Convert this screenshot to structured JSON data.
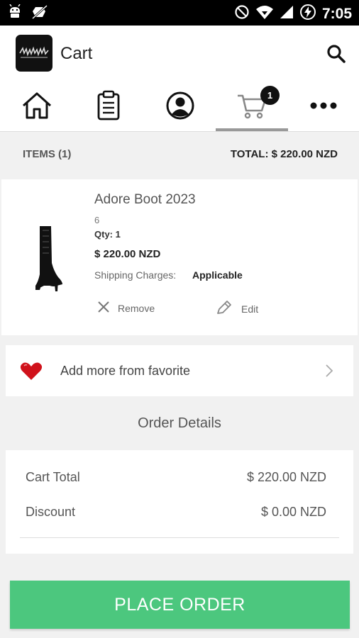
{
  "status_bar": {
    "time": "7:05",
    "icons": [
      "android-icon",
      "no-notifications-icon",
      "do-not-disturb-icon",
      "wifi-icon",
      "signal-icon",
      "battery-charging-icon"
    ]
  },
  "app_bar": {
    "title": "Cart",
    "logo_icon": "brand-logo",
    "search_icon": "search-icon"
  },
  "nav": {
    "items": [
      {
        "name": "home",
        "icon": "home-icon"
      },
      {
        "name": "orders",
        "icon": "clipboard-icon"
      },
      {
        "name": "account",
        "icon": "user-circle-icon"
      },
      {
        "name": "cart",
        "icon": "cart-icon",
        "active": true
      },
      {
        "name": "more",
        "icon": "more-dots-icon"
      }
    ],
    "cart_badge": "1"
  },
  "summary": {
    "items_label": "ITEMS (1)",
    "total_label": "TOTAL: $ 220.00 NZD"
  },
  "product": {
    "name": "Adore Boot 2023",
    "size": "6",
    "qty": "Qty: 1",
    "price": "$ 220.00 NZD",
    "shipping_label": "Shipping Charges:",
    "shipping_value": "Applicable",
    "remove_label": "Remove",
    "edit_label": "Edit"
  },
  "favorite": {
    "label": "Add more from favorite"
  },
  "order_details": {
    "title": "Order Details",
    "rows": [
      {
        "label": "Cart Total",
        "value": "$ 220.00 NZD"
      },
      {
        "label": "Discount",
        "value": "$ 0.00 NZD"
      }
    ]
  },
  "place_order_label": "PLACE ORDER",
  "colors": {
    "accent": "#4cc77e",
    "heart": "#d0121b",
    "status_bar": "#000000"
  }
}
